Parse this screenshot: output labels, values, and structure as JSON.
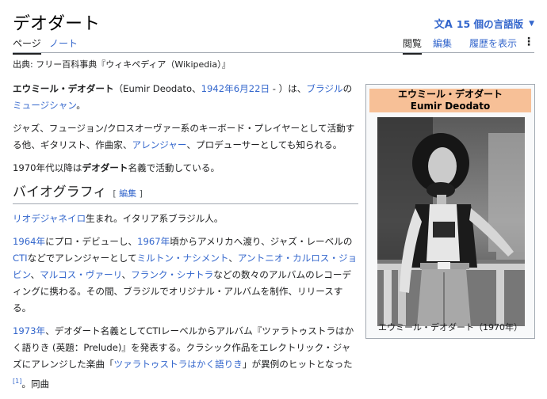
{
  "header": {
    "title": "デオダート",
    "lang_label": "15 個の言語版"
  },
  "tabs": {
    "page": "ページ",
    "note": "ノート",
    "read": "閲覧",
    "edit": "編集",
    "history": "履歴を表示"
  },
  "source_line": "出典: フリー百科事典『ウィキペディア（Wikipedia）』",
  "article": {
    "p1": {
      "name": "エウミール・デオダート",
      "t1": "（Eumir Deodato、",
      "date_link": "1942年6月22日",
      "t2": " - ）は、",
      "brazil_link": "ブラジル",
      "t3": "の",
      "musician_link": "ミュージシャン",
      "t4": "。"
    },
    "p2": {
      "t1": "ジャズ、フュージョン/クロスオーヴァー系のキーボード・プレイヤーとして活動する他、ギタリスト、作曲家、",
      "arranger_link": "アレンジャー",
      "t2": "、プロデューサーとしても知られる。"
    },
    "p3": {
      "t1": "1970年代以降は",
      "bold": "デオダート",
      "t2": "名義で活動している。"
    },
    "section_bio": "バイオグラフィ",
    "edit_link": "編集",
    "p4": {
      "rio_link": "リオデジャネイロ",
      "t1": "生まれ。イタリア系ブラジル人。"
    },
    "p5": {
      "y1964_link": "1964年",
      "t1": "にプロ・デビューし、",
      "y1967_link": "1967年",
      "t2": "頃からアメリカへ渡り、ジャズ・レーベルの",
      "cti_link": "CTI",
      "t3": "などでアレンジャーとして",
      "milton_link": "ミルトン・ナシメント",
      "t4": "、",
      "jobim_link": "アントニオ・カルロス・ジョビン",
      "t5": "、",
      "marcos_link": "マルコス・ヴァーリ",
      "t6": "、",
      "sinatra_link": "フランク・シナトラ",
      "t7": "などの数々のアルバムのレコーディングに携わる。その間、ブラジルでオリジナル・アルバムを制作、リリースする。"
    },
    "p6": {
      "y1973_link": "1973年",
      "t1": "、デオダート名義としてCTIレーベルからアルバム『ツァラトゥストラはかく語りき (英題：Prelude)』を発表する。クラシック作品をエレクトリック・ジャズにアレンジした楽曲「",
      "zara_link": "ツァラトゥストラはかく語りき",
      "t2": "」が異例のヒットとなった",
      "ref": "[1]",
      "t3": "。同曲"
    }
  },
  "infobox": {
    "name_ja": "エウミール・デオダート",
    "name_en": "Eumir Deodato",
    "caption": "エウミール・デオダート（1970年）"
  }
}
